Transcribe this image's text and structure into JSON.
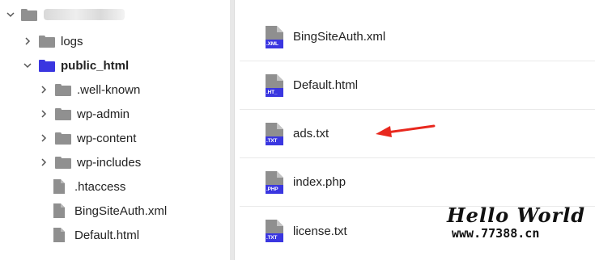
{
  "tree": {
    "root_label": "",
    "items": [
      {
        "label": "logs",
        "kind": "folder",
        "expanded": false
      },
      {
        "label": "public_html",
        "kind": "folder",
        "expanded": true,
        "active": true
      },
      {
        "label": ".well-known",
        "kind": "folder",
        "expanded": false
      },
      {
        "label": "wp-admin",
        "kind": "folder",
        "expanded": false
      },
      {
        "label": "wp-content",
        "kind": "folder",
        "expanded": false
      },
      {
        "label": "wp-includes",
        "kind": "folder",
        "expanded": false
      },
      {
        "label": ".htaccess",
        "kind": "file"
      },
      {
        "label": "BingSiteAuth.xml",
        "kind": "file"
      },
      {
        "label": "Default.html",
        "kind": "file"
      }
    ]
  },
  "files": [
    {
      "name": "BingSiteAuth.xml",
      "ext": ".XML"
    },
    {
      "name": "Default.html",
      "ext": ".HT_"
    },
    {
      "name": "ads.txt",
      "ext": ".TXT"
    },
    {
      "name": "index.php",
      "ext": ".PHP"
    },
    {
      "name": "license.txt",
      "ext": ".TXT"
    }
  ],
  "watermark": {
    "title": "Hello World",
    "url": "www.77388.cn"
  },
  "colors": {
    "accent": "#3a36e0",
    "folder_gray": "#909090",
    "arrow_red": "#e8281e",
    "doc_gray": "#8f8f8f"
  }
}
